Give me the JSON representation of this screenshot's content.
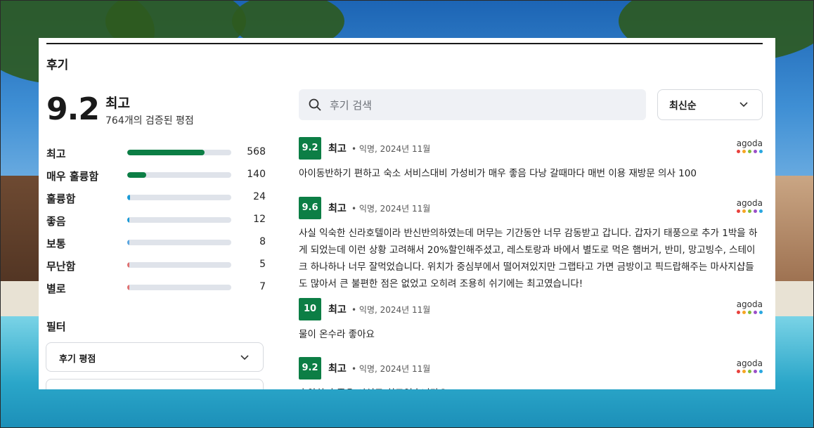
{
  "section_title": "후기",
  "summary": {
    "score": "9.2",
    "label": "최고",
    "count_text": "764개의 검증된 평점"
  },
  "distribution": [
    {
      "label": "최고",
      "count": "568",
      "fraction": 0.74,
      "color": "#0c7e45"
    },
    {
      "label": "매우 훌륭함",
      "count": "140",
      "fraction": 0.18,
      "color": "#0c7e45"
    },
    {
      "label": "훌륭함",
      "count": "24",
      "fraction": 0.03,
      "color": "#1a9ad6"
    },
    {
      "label": "좋음",
      "count": "12",
      "fraction": 0.02,
      "color": "#1a9ad6"
    },
    {
      "label": "보통",
      "count": "8",
      "fraction": 0.01,
      "color": "#5aa6e0"
    },
    {
      "label": "무난함",
      "count": "5",
      "fraction": 0.01,
      "color": "#e07070"
    },
    {
      "label": "별로",
      "count": "7",
      "fraction": 0.01,
      "color": "#e07070"
    }
  ],
  "filter": {
    "heading": "필터",
    "select_label": "후기 평점"
  },
  "search": {
    "placeholder": "후기 검색",
    "icon": "search-icon"
  },
  "sort": {
    "label": "최신순"
  },
  "reviews": [
    {
      "score": "9.2",
      "label": "최고",
      "meta": "익명, 2024년 11월",
      "source": "agoda",
      "text": "아이동반하기 편하고 숙소 서비스대비 가성비가 매우 좋음 다낭 갈때마다 매번 이용 재방문 의사 100"
    },
    {
      "score": "9.6",
      "label": "최고",
      "meta": "익명, 2024년 11월",
      "source": "agoda",
      "text": "사실 익숙한 신라호텔이라 반신반의하였는데 머무는 기간동안 너무 감동받고 갑니다. 갑자기 태풍으로 추가 1박을 하게 되었는데 이런 상황 고려해서 20%할인해주셨고, 레스토랑과 바에서 별도로 먹은 햄버거, 반미, 망고빙수, 스테이크 하나하나 너무 잘먹었습니다. 위치가 중심부에서 떨어져있지만 그랩타고 가면 금방이고 픽드랍해주는 마사지샵들도 많아서 큰 불편한 점은 없었고 오히려 조용히 쉬기에는 최고였습니다!"
    },
    {
      "score": "10",
      "label": "최고",
      "meta": "익명, 2024년 11월",
      "source": "agoda",
      "text": "물이 온수라 좋아요"
    },
    {
      "score": "9.2",
      "label": "최고",
      "meta": "익명, 2024년 11월",
      "source": "agoda",
      "text": "휴양하기 좋은 시설로 최고였습니다요"
    }
  ],
  "agoda_dot_colors": [
    "#e8413c",
    "#f5a623",
    "#7fbd3a",
    "#9b4fc7",
    "#2aa7e0"
  ]
}
